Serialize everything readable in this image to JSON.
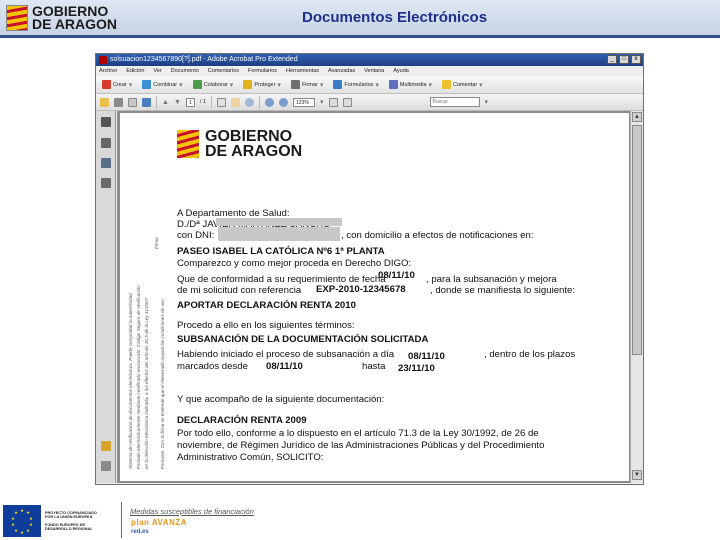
{
  "slide": {
    "logo_line1": "GOBIERNO",
    "logo_line2": "DE ARAGON",
    "title": "Documentos Electrónicos"
  },
  "window": {
    "title": "solsuacion1234567890[?].pdf - Adobe Acrobat Pro Extended",
    "controls": [
      "_",
      "□",
      "x"
    ]
  },
  "menubar": [
    "Archivo",
    "Edición",
    "Ver",
    "Documento",
    "Comentarios",
    "Formularios",
    "Herramientas",
    "Avanzadas",
    "Ventana",
    "Ayuda"
  ],
  "toolbar1": [
    {
      "label": "Crear",
      "icon": "create-icon",
      "color": "#d93a2b"
    },
    {
      "label": "Combinar",
      "icon": "combine-icon",
      "color": "#3d8fd4"
    },
    {
      "label": "Colaborar",
      "icon": "collaborate-icon",
      "color": "#4c9c4a"
    },
    {
      "label": "Proteger",
      "icon": "lock-icon",
      "color": "#e3b21c"
    },
    {
      "label": "Firmar",
      "icon": "pen-icon",
      "color": "#6e6e6e"
    },
    {
      "label": "Formularios",
      "icon": "form-icon",
      "color": "#3a7cc4"
    },
    {
      "label": "Multimedia",
      "icon": "film-icon",
      "color": "#5e6fbf"
    },
    {
      "label": "Comentar",
      "icon": "comment-icon",
      "color": "#e9c12a"
    }
  ],
  "toolbar2": {
    "page_current": "1",
    "page_total": "/ 1",
    "zoom": "123%",
    "search_placeholder": "Buscar"
  },
  "doc": {
    "logo_line1": "GOBIERNO",
    "logo_line2": "DE ARAGON",
    "addressee": "A Departamento de Salud:",
    "name_line": "D./Dª  JAVIER MARTÍNEZ SANCHO",
    "dni_prefix": "con DNI:",
    "domicilio": ", con domicilio a efectos de notificaciones en:",
    "address": "PASEO ISABEL LA CATÓLICA Nº6 1ª PLANTA",
    "comparezco": "Comparezco y como mejor proceda en Derecho DIGO:",
    "que_prefix": "Que de conformidad a su requerimiento de fecha",
    "fecha1": "08/11/10",
    "que_suffix": ", para la subsanación y mejora",
    "solicitud_prefix": "de mi solicitud con referencia",
    "referencia": "EXP-2010-12345678",
    "solicitud_suffix": ", donde se manifiesta lo siguiente:",
    "aportar": "APORTAR DECLARACIÓN RENTA 2010",
    "procedo": "Procedo a ello en los siguientes términos:",
    "subsanacion": "SUBSANACIÓN DE LA DOCUMENTACIÓN SOLICITADA",
    "habiendo": "Habiendo iniciado el proceso de subsanación a día",
    "fecha2": "08/11/10",
    "plazos": ", dentro de los plazos",
    "marcados": "marcados desde",
    "desde": "08/11/10",
    "hasta_label": "hasta",
    "hasta": "23/11/10",
    "acompano": "Y que acompaño de la siguiente documentación:",
    "declaracion": "DECLARACIÓN RENTA 2009",
    "por_todo": "Por todo ello, conforme a lo dispuesto en el artículo 71.3 de la Ley 30/1992, de 26 de",
    "noviembre": "noviembre, de Régimen Jurídico de las Administraciones Públicas y del Procedimiento",
    "administrativo": "Administrativo Común, SOLICITO:",
    "margin_lines": [
      "Sistema de verificación de documentos electrónicos. Puede comprobar la autenticidad",
      "Firmado electrónicamente mediante certificado reconocido. Código Seguro de Verificación",
      "en la dirección electrónica indicada, a los efectos del artículo 30.5 de la Ley 11/2007",
      "Firma",
      "Firmante. Con la firma se entiende que el interesado acepta las condiciones de uso"
    ]
  },
  "footer": {
    "eu_line1": "PROYECTO COFINANCIADO",
    "eu_line2": "POR LA UNIÓN EUROPEA",
    "eu_line3": "FONDO EUROPEO DE",
    "eu_line4": "DESARROLLO REGIONAL",
    "note": "Medidas susceptibles de financiación",
    "logo1": "plan AVANZA",
    "logo2": "red.es"
  }
}
